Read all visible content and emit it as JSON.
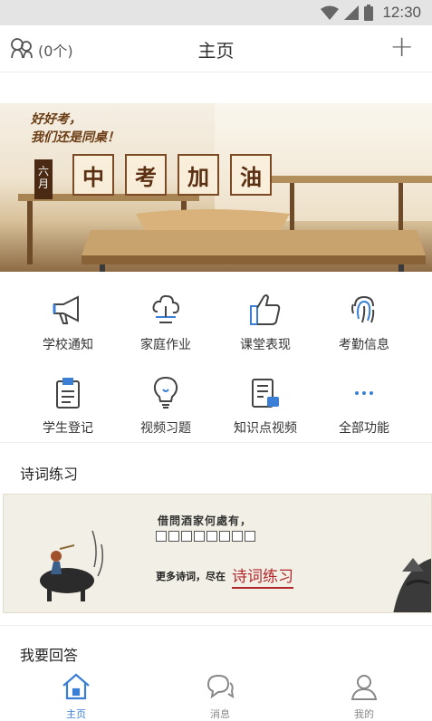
{
  "status_bar": {
    "time": "12:30",
    "icons": [
      "wifi-icon",
      "signal-icon",
      "battery-icon"
    ]
  },
  "header": {
    "title": "主页",
    "count": "(0个)",
    "add_label": "+"
  },
  "banner": {
    "slogan_line1": "好好考，",
    "slogan_line2": "我们还是同桌！",
    "month": "六月",
    "tiles": [
      "中",
      "考",
      "加",
      "油"
    ]
  },
  "grid": {
    "items": [
      {
        "label": "学校通知",
        "icon": "megaphone-icon"
      },
      {
        "label": "家庭作业",
        "icon": "homework-icon"
      },
      {
        "label": "课堂表现",
        "icon": "thumbs-up-icon"
      },
      {
        "label": "考勤信息",
        "icon": "fingerprint-icon"
      },
      {
        "label": "学生登记",
        "icon": "clipboard-icon"
      },
      {
        "label": "视频习题",
        "icon": "lightbulb-icon"
      },
      {
        "label": "知识点视频",
        "icon": "video-doc-icon"
      },
      {
        "label": "全部功能",
        "icon": "more-icon"
      }
    ]
  },
  "poetry": {
    "title": "诗词练习",
    "line": "借問酒家何處有，",
    "more_text": "更多诗词，尽在",
    "link": "诗词练习"
  },
  "answer": {
    "title": "我要回答"
  },
  "tabbar": {
    "tabs": [
      {
        "label": "主页",
        "icon": "home-icon",
        "active": true
      },
      {
        "label": "消息",
        "icon": "chat-icon",
        "active": false
      },
      {
        "label": "我的",
        "icon": "user-icon",
        "active": false
      }
    ]
  },
  "colors": {
    "accent": "#3a7fd5",
    "poem_red": "#b1262b",
    "banner_brown": "#5a2f12"
  }
}
